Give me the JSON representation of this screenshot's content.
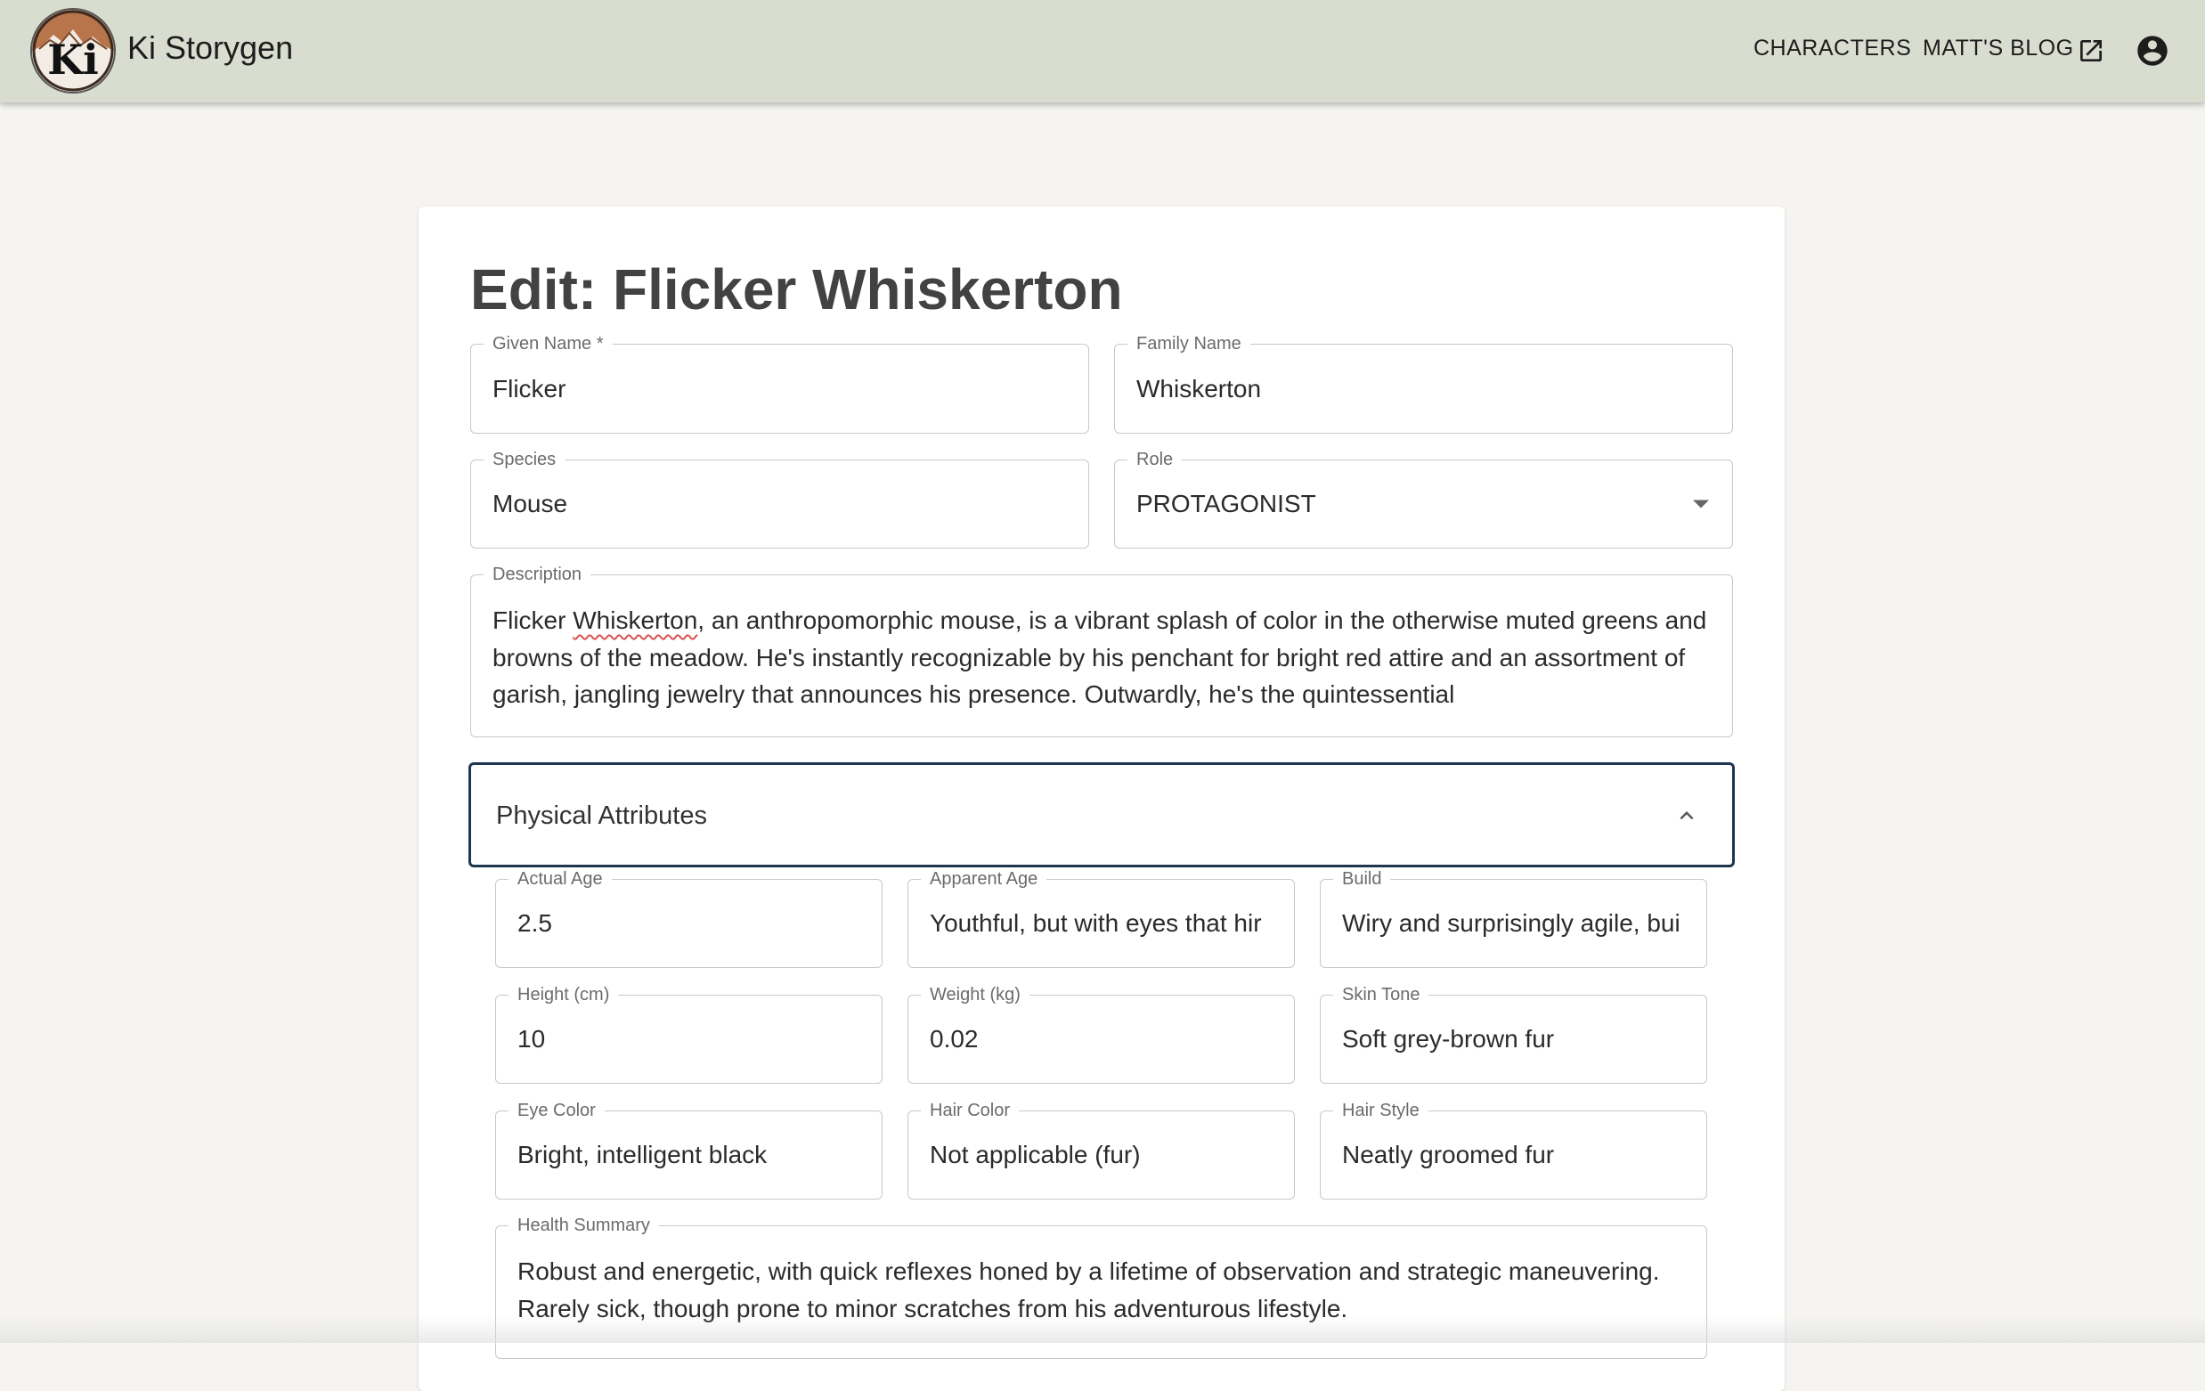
{
  "appbar": {
    "title": "Ki Storygen",
    "logo_text": "Ki",
    "nav": {
      "characters": "CHARACTERS",
      "blog": "MATT'S BLOG"
    },
    "icons": {
      "external": "open-in-new-icon",
      "account": "account-circle-icon"
    }
  },
  "editor": {
    "title": "Edit: Flicker Whiskerton",
    "fields": {
      "given_name": {
        "label": "Given Name *",
        "value": "Flicker"
      },
      "family_name": {
        "label": "Family Name",
        "value": "Whiskerton"
      },
      "species": {
        "label": "Species",
        "value": "Mouse"
      },
      "role": {
        "label": "Role",
        "value": "PROTAGONIST"
      },
      "description": {
        "label": "Description",
        "value_start": "Flicker ",
        "value_misspelled": "Whiskerton",
        "value_rest": ", an anthropomorphic mouse, is a vibrant splash of color in the otherwise muted greens and browns of the meadow. He's instantly recognizable by his penchant for bright red attire and an assortment of garish, jangling jewelry that announces his presence. Outwardly, he's the quintessential"
      }
    },
    "physical": {
      "section_label": "Physical Attributes",
      "actual_age": {
        "label": "Actual Age",
        "value": "2.5"
      },
      "apparent_age": {
        "label": "Apparent Age",
        "value": "Youthful, but with eyes that hir"
      },
      "build": {
        "label": "Build",
        "value": "Wiry and surprisingly agile, bui"
      },
      "height": {
        "label": "Height (cm)",
        "value": "10"
      },
      "weight": {
        "label": "Weight (kg)",
        "value": "0.02"
      },
      "skin_tone": {
        "label": "Skin Tone",
        "value": "Soft grey-brown fur"
      },
      "eye_color": {
        "label": "Eye Color",
        "value": "Bright, intelligent black"
      },
      "hair_color": {
        "label": "Hair Color",
        "value": "Not applicable (fur)"
      },
      "hair_style": {
        "label": "Hair Style",
        "value": "Neatly groomed fur"
      },
      "health_summary": {
        "label": "Health Summary",
        "value": "Robust and energetic, with quick reflexes honed by a lifetime of observation and strategic maneuvering. Rarely sick, though prone to minor scratches from his adventurous lifestyle."
      }
    }
  },
  "colors": {
    "appbar_bg": "#d9ddcf",
    "page_bg": "#f5f4f1",
    "focus_border": "#1f3550"
  }
}
